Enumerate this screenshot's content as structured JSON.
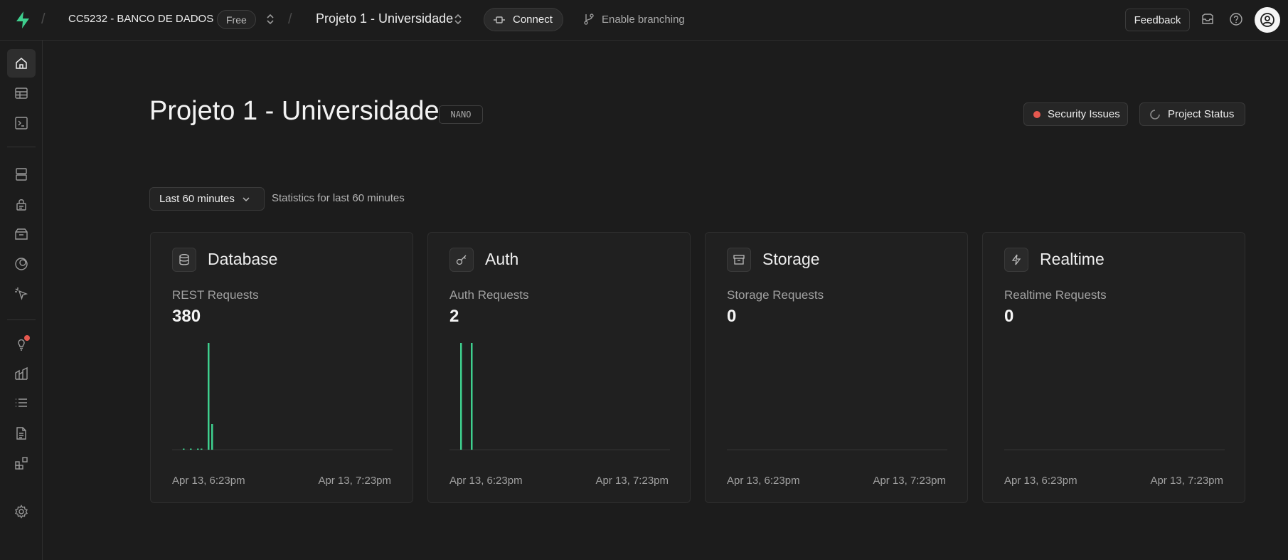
{
  "topbar": {
    "org_name": "CC5232 - BANCO DE DADOS",
    "plan": "Free",
    "project_name": "Projeto 1 - Universidade",
    "connect_label": "Connect",
    "branching_label": "Enable branching",
    "feedback_label": "Feedback"
  },
  "sidebar": {
    "items": [
      {
        "name": "home-icon",
        "active": true
      },
      {
        "name": "table-editor-icon"
      },
      {
        "name": "sql-editor-icon"
      },
      {
        "name": "database-icon"
      },
      {
        "name": "auth-lock-icon"
      },
      {
        "name": "storage-icon"
      },
      {
        "name": "edge-functions-icon"
      },
      {
        "name": "realtime-cursor-icon"
      },
      {
        "name": "advisors-bulb-icon"
      },
      {
        "name": "reports-icon"
      },
      {
        "name": "logs-icon"
      },
      {
        "name": "api-docs-icon"
      },
      {
        "name": "integrations-icon"
      },
      {
        "name": "settings-icon"
      }
    ]
  },
  "main": {
    "title": "Projeto 1 - Universidade",
    "compute_badge": "NANO",
    "security_label": "Security Issues",
    "status_label": "Project Status",
    "range_label": "Last 60 minutes",
    "range_note": "Statistics for last 60 minutes"
  },
  "cards": [
    {
      "title": "Database",
      "metric_label": "REST Requests",
      "metric_value": "380",
      "icon": "database-icon",
      "axis_start": "Apr 13, 6:23pm",
      "axis_end": "Apr 13, 7:23pm"
    },
    {
      "title": "Auth",
      "metric_label": "Auth Requests",
      "metric_value": "2",
      "icon": "key-icon",
      "axis_start": "Apr 13, 6:23pm",
      "axis_end": "Apr 13, 7:23pm"
    },
    {
      "title": "Storage",
      "metric_label": "Storage Requests",
      "metric_value": "0",
      "icon": "archive-icon",
      "axis_start": "Apr 13, 6:23pm",
      "axis_end": "Apr 13, 7:23pm"
    },
    {
      "title": "Realtime",
      "metric_label": "Realtime Requests",
      "metric_value": "0",
      "icon": "bolt-icon",
      "axis_start": "Apr 13, 6:23pm",
      "axis_end": "Apr 13, 7:23pm"
    }
  ],
  "chart_data": [
    {
      "type": "bar",
      "title": "REST Requests",
      "buckets": 60,
      "values": {
        "2": 1,
        "4": 1,
        "6": 1,
        "7": 1,
        "9": 150,
        "10": 36
      }
    },
    {
      "type": "bar",
      "title": "Auth Requests",
      "buckets": 60,
      "values": {
        "2": 1,
        "5": 1
      }
    },
    {
      "type": "bar",
      "title": "Storage Requests",
      "buckets": 60,
      "values": {}
    },
    {
      "type": "bar",
      "title": "Realtime Requests",
      "buckets": 60,
      "values": {}
    }
  ],
  "colors": {
    "accent": "#3ecf8e",
    "danger": "#e5584f",
    "background": "#1c1c1c"
  }
}
